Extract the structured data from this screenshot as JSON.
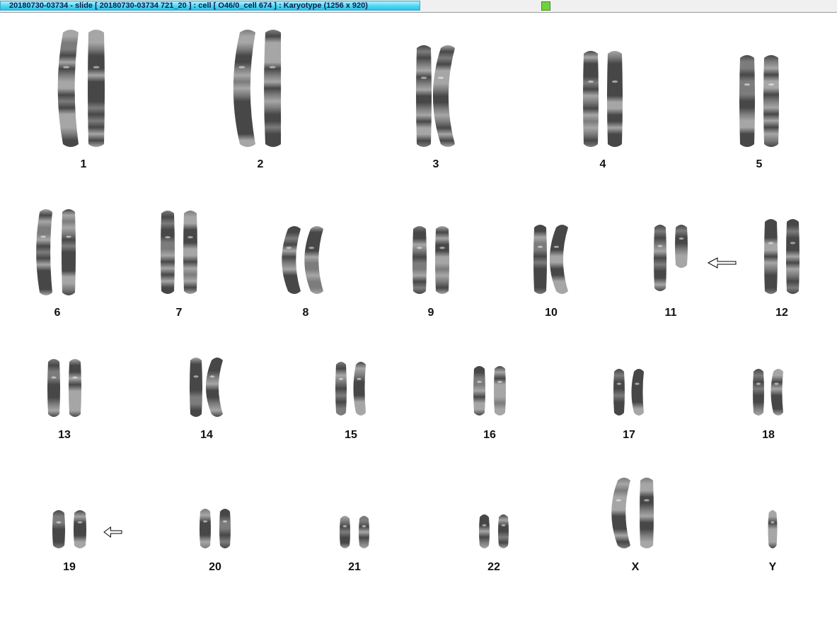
{
  "window": {
    "title": "20180730-03734 - slide [ 20180730-03734 721_20 ] : cell [ O46/0_cell 674 ] : Karyotype  (1256 x 920)"
  },
  "karyotype": {
    "chromosomes": [
      {
        "id": "1",
        "label": "1"
      },
      {
        "id": "2",
        "label": "2"
      },
      {
        "id": "3",
        "label": "3"
      },
      {
        "id": "4",
        "label": "4"
      },
      {
        "id": "5",
        "label": "5"
      },
      {
        "id": "6",
        "label": "6"
      },
      {
        "id": "7",
        "label": "7"
      },
      {
        "id": "8",
        "label": "8"
      },
      {
        "id": "9",
        "label": "9"
      },
      {
        "id": "10",
        "label": "10"
      },
      {
        "id": "11",
        "label": "11"
      },
      {
        "id": "12",
        "label": "12"
      },
      {
        "id": "13",
        "label": "13"
      },
      {
        "id": "14",
        "label": "14"
      },
      {
        "id": "15",
        "label": "15"
      },
      {
        "id": "16",
        "label": "16"
      },
      {
        "id": "17",
        "label": "17"
      },
      {
        "id": "18",
        "label": "18"
      },
      {
        "id": "19",
        "label": "19"
      },
      {
        "id": "20",
        "label": "20"
      },
      {
        "id": "21",
        "label": "21"
      },
      {
        "id": "22",
        "label": "22"
      },
      {
        "id": "X",
        "label": "X"
      },
      {
        "id": "Y",
        "label": "Y"
      }
    ],
    "abnormality_markers": [
      {
        "chromosome": "11",
        "icon": "arrow-left-icon"
      },
      {
        "chromosome": "19",
        "icon": "arrow-left-icon"
      }
    ]
  },
  "colors": {
    "title_tab": "#4fd6f5",
    "status_led": "#6fd33b",
    "chromosome_dark": "#2e2e2e",
    "chromosome_light": "#9a9a9a"
  }
}
